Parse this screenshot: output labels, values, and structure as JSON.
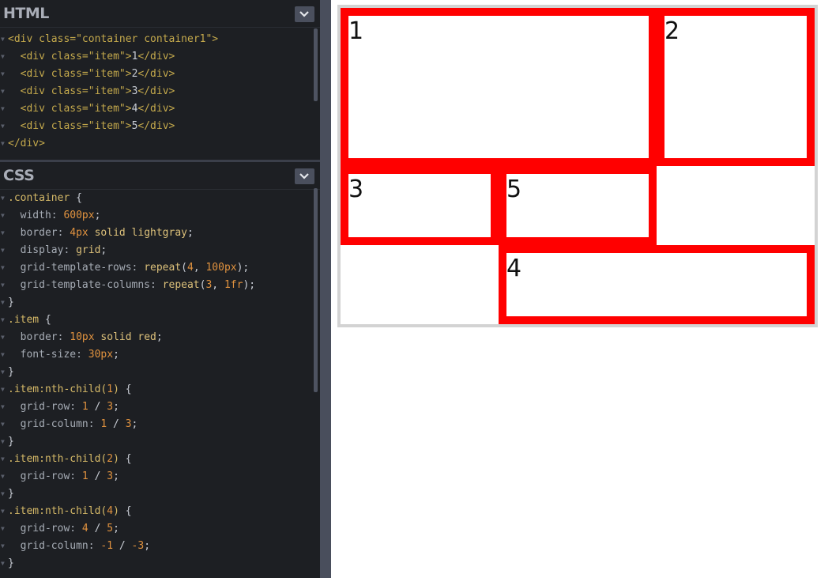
{
  "html_pane": {
    "title": "HTML",
    "lines": [
      {
        "open": "<div",
        "attr": " class=",
        "val": "\"container container1\"",
        "close": ">",
        "text": "",
        "end": "",
        "indent": ""
      },
      {
        "indent": "  ",
        "open": "<div",
        "attr": " class=",
        "val": "\"item\"",
        "close": ">",
        "text": "1",
        "end": "</div>"
      },
      {
        "indent": "  ",
        "open": "<div",
        "attr": " class=",
        "val": "\"item\"",
        "close": ">",
        "text": "2",
        "end": "</div>"
      },
      {
        "indent": "  ",
        "open": "<div",
        "attr": " class=",
        "val": "\"item\"",
        "close": ">",
        "text": "3",
        "end": "</div>"
      },
      {
        "indent": "  ",
        "open": "<div",
        "attr": " class=",
        "val": "\"item\"",
        "close": ">",
        "text": "4",
        "end": "</div>"
      },
      {
        "indent": "  ",
        "open": "<div",
        "attr": " class=",
        "val": "\"item\"",
        "close": ">",
        "text": "5",
        "end": "</div>"
      },
      {
        "indent": "",
        "open": "</div>",
        "attr": "",
        "val": "",
        "close": "",
        "text": "",
        "end": ""
      }
    ]
  },
  "css_pane": {
    "title": "CSS",
    "lines": [
      [
        {
          "t": "sel",
          "v": ".container"
        },
        {
          "t": "punc",
          "v": " {"
        }
      ],
      [
        {
          "t": "prop",
          "v": "  width: "
        },
        {
          "t": "num",
          "v": "600px"
        },
        {
          "t": "punc",
          "v": ";"
        }
      ],
      [
        {
          "t": "prop",
          "v": "  border: "
        },
        {
          "t": "num",
          "v": "4px"
        },
        {
          "t": "kw",
          "v": " solid lightgray"
        },
        {
          "t": "punc",
          "v": ";"
        }
      ],
      [
        {
          "t": "prop",
          "v": "  display: "
        },
        {
          "t": "kw",
          "v": "grid"
        },
        {
          "t": "punc",
          "v": ";"
        }
      ],
      [
        {
          "t": "prop",
          "v": "  grid-template-rows: "
        },
        {
          "t": "kw",
          "v": "repeat"
        },
        {
          "t": "punc",
          "v": "("
        },
        {
          "t": "num",
          "v": "4"
        },
        {
          "t": "punc",
          "v": ", "
        },
        {
          "t": "num",
          "v": "100px"
        },
        {
          "t": "punc",
          "v": ");"
        }
      ],
      [
        {
          "t": "prop",
          "v": "  grid-template-columns: "
        },
        {
          "t": "kw",
          "v": "repeat"
        },
        {
          "t": "punc",
          "v": "("
        },
        {
          "t": "num",
          "v": "3"
        },
        {
          "t": "punc",
          "v": ", "
        },
        {
          "t": "num",
          "v": "1fr"
        },
        {
          "t": "punc",
          "v": ");"
        }
      ],
      [
        {
          "t": "punc",
          "v": "}"
        }
      ],
      [
        {
          "t": "sel",
          "v": ".item"
        },
        {
          "t": "punc",
          "v": " {"
        }
      ],
      [
        {
          "t": "prop",
          "v": "  border: "
        },
        {
          "t": "num",
          "v": "10px"
        },
        {
          "t": "kw",
          "v": " solid red"
        },
        {
          "t": "punc",
          "v": ";"
        }
      ],
      [
        {
          "t": "prop",
          "v": "  font-size: "
        },
        {
          "t": "num",
          "v": "30px"
        },
        {
          "t": "punc",
          "v": ";"
        }
      ],
      [
        {
          "t": "punc",
          "v": "}"
        }
      ],
      [
        {
          "t": "sel",
          "v": ".item:nth-child("
        },
        {
          "t": "num",
          "v": "1"
        },
        {
          "t": "sel",
          "v": ")"
        },
        {
          "t": "punc",
          "v": " {"
        }
      ],
      [
        {
          "t": "prop",
          "v": "  grid-row: "
        },
        {
          "t": "num",
          "v": "1"
        },
        {
          "t": "punc",
          "v": " / "
        },
        {
          "t": "num",
          "v": "3"
        },
        {
          "t": "punc",
          "v": ";"
        }
      ],
      [
        {
          "t": "prop",
          "v": "  grid-column: "
        },
        {
          "t": "num",
          "v": "1"
        },
        {
          "t": "punc",
          "v": " / "
        },
        {
          "t": "num",
          "v": "3"
        },
        {
          "t": "punc",
          "v": ";"
        }
      ],
      [
        {
          "t": "punc",
          "v": "}"
        }
      ],
      [
        {
          "t": "sel",
          "v": ".item:nth-child("
        },
        {
          "t": "num",
          "v": "2"
        },
        {
          "t": "sel",
          "v": ")"
        },
        {
          "t": "punc",
          "v": " {"
        }
      ],
      [
        {
          "t": "prop",
          "v": "  grid-row: "
        },
        {
          "t": "num",
          "v": "1"
        },
        {
          "t": "punc",
          "v": " / "
        },
        {
          "t": "num",
          "v": "3"
        },
        {
          "t": "punc",
          "v": ";"
        }
      ],
      [
        {
          "t": "punc",
          "v": "}"
        }
      ],
      [
        {
          "t": "sel",
          "v": ".item:nth-child("
        },
        {
          "t": "num",
          "v": "4"
        },
        {
          "t": "sel",
          "v": ")"
        },
        {
          "t": "punc",
          "v": " {"
        }
      ],
      [
        {
          "t": "prop",
          "v": "  grid-row: "
        },
        {
          "t": "num",
          "v": "4"
        },
        {
          "t": "punc",
          "v": " / "
        },
        {
          "t": "num",
          "v": "5"
        },
        {
          "t": "punc",
          "v": ";"
        }
      ],
      [
        {
          "t": "prop",
          "v": "  grid-column: "
        },
        {
          "t": "num",
          "v": "-1"
        },
        {
          "t": "punc",
          "v": " / "
        },
        {
          "t": "num",
          "v": "-3"
        },
        {
          "t": "punc",
          "v": ";"
        }
      ],
      [
        {
          "t": "punc",
          "v": "}"
        }
      ]
    ]
  },
  "preview": {
    "items": [
      "1",
      "2",
      "3",
      "4",
      "5"
    ]
  },
  "colors": {
    "editor_bg": "#1d1f23",
    "divider": "#494e5c",
    "item_border": "#ff0000",
    "container_border": "#d3d3d3"
  },
  "icons": {
    "collapse": "chevron-down-icon"
  }
}
